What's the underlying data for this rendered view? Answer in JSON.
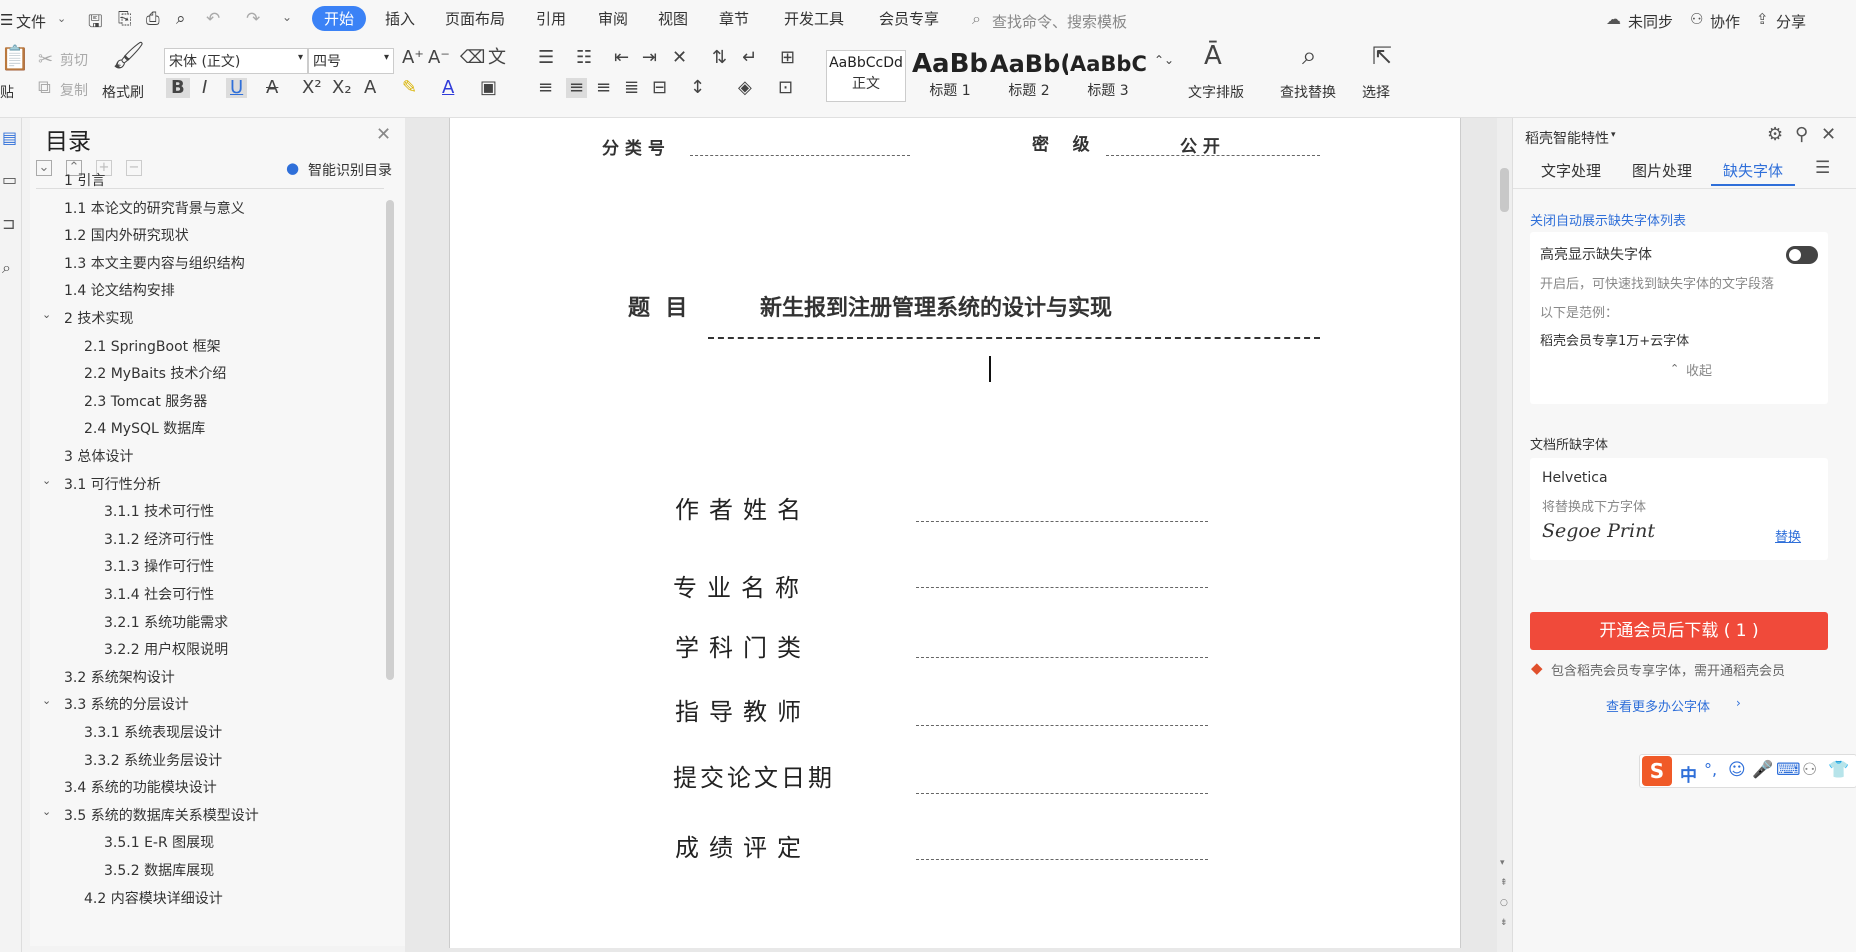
{
  "menu": {
    "file": "文件"
  },
  "tabs": [
    "开始",
    "插入",
    "页面布局",
    "引用",
    "审阅",
    "视图",
    "章节",
    "开发工具",
    "会员专享"
  ],
  "search": {
    "placeholder": "查找命令、搜索模板"
  },
  "top_right": {
    "sync": "未同步",
    "collab": "协作",
    "share": "分享"
  },
  "ribbon": {
    "paste": "贴",
    "cut": "剪切",
    "copy": "复制",
    "format_painter": "格式刷",
    "font_name": "宋体 (正文)",
    "font_size": "四号",
    "styles": [
      {
        "sample": "AaBbCcDd",
        "label": "正文"
      },
      {
        "sample": "AaBb",
        "label": "标题 1"
      },
      {
        "sample": "AaBb(",
        "label": "标题 2"
      },
      {
        "sample": "AaBbC(",
        "label": "标题 3"
      }
    ],
    "text_layout": "文字排版",
    "find_replace": "查找替换",
    "select": "选择"
  },
  "toc": {
    "title": "目录",
    "smart": "智能识别目录",
    "items": [
      {
        "text": "1 引言",
        "indent": 0,
        "caret": false
      },
      {
        "text": "1.1 本论文的研究背景与意义",
        "indent": 0,
        "caret": false
      },
      {
        "text": "1.2 国内外研究现状",
        "indent": 0,
        "caret": false
      },
      {
        "text": "1.3 本文主要内容与组织结构",
        "indent": 0,
        "caret": false
      },
      {
        "text": "1.4  论文结构安排",
        "indent": 0,
        "caret": false
      },
      {
        "text": "2  技术实现",
        "indent": 0,
        "caret": true
      },
      {
        "text": "2.1 SpringBoot 框架",
        "indent": 1,
        "caret": false
      },
      {
        "text": "2.2 MyBaits 技术介绍",
        "indent": 1,
        "caret": false
      },
      {
        "text": "2.3 Tomcat 服务器",
        "indent": 1,
        "caret": false
      },
      {
        "text": "2.4 MySQL 数据库",
        "indent": 1,
        "caret": false
      },
      {
        "text": "3 总体设计",
        "indent": 0,
        "caret": false
      },
      {
        "text": "3.1  可行性分析",
        "indent": 0,
        "caret": true
      },
      {
        "text": "3.1.1  技术可行性",
        "indent": 2,
        "caret": false
      },
      {
        "text": "3.1.2  经济可行性",
        "indent": 2,
        "caret": false
      },
      {
        "text": "3.1.3  操作可行性",
        "indent": 2,
        "caret": false
      },
      {
        "text": "3.1.4  社会可行性",
        "indent": 2,
        "caret": false
      },
      {
        "text": "3.2.1  系统功能需求",
        "indent": 2,
        "caret": false
      },
      {
        "text": "3.2.2  用户权限说明",
        "indent": 2,
        "caret": false
      },
      {
        "text": "3.2 系统架构设计",
        "indent": 0,
        "caret": false
      },
      {
        "text": "3.3 系统的分层设计",
        "indent": 0,
        "caret": true
      },
      {
        "text": "3.3.1  系统表现层设计",
        "indent": 1,
        "caret": false
      },
      {
        "text": "3.3.2  系统业务层设计",
        "indent": 1,
        "caret": false
      },
      {
        "text": "3.4 系统的功能模块设计",
        "indent": 0,
        "caret": false
      },
      {
        "text": "3.5 系统的数据库关系模型设计",
        "indent": 0,
        "caret": true
      },
      {
        "text": "3.5.1 E-R 图展现",
        "indent": 2,
        "caret": false
      },
      {
        "text": "3.5.2 数据库展现",
        "indent": 2,
        "caret": false
      },
      {
        "text": "4.2  内容模块详细设计",
        "indent": 1,
        "caret": false
      }
    ]
  },
  "doc": {
    "class_no": "分 类 号",
    "secret_level": "密    级",
    "secret_value": "公 开",
    "title_label": "题  目",
    "title_value": "新生报到注册管理系统的设计与实现",
    "fields": [
      "作者姓名",
      "专业名称",
      "学科门类",
      "指导教师",
      "提交论文日期",
      "成绩评定"
    ]
  },
  "panel": {
    "header": "稻壳智能特性",
    "tabs": [
      "文字处理",
      "图片处理",
      "缺失字体"
    ],
    "close_auto": "关闭自动展示缺失字体列表",
    "highlight": "高亮显示缺失字体",
    "desc1": "开启后，可快速找到缺失字体的文字段落",
    "desc2": "以下是范例：",
    "example": "稻壳会员专享1万+云字体",
    "collapse": "收起",
    "missing_title": "文档所缺字体",
    "missing_font": "Helvetica",
    "replace_hint": "将替换成下方字体",
    "replace_font": "Segoe Print",
    "replace_btn": "替换",
    "download_btn": "开通会员后下载 ( 1 )",
    "note": "包含稻壳会员专享字体，需开通稻壳会员",
    "more": "查看更多办公字体"
  },
  "ime": {
    "label": "中"
  },
  "colors": {
    "accent": "#3b82f6",
    "download": "#f04a3a",
    "link": "#2f6fd9"
  }
}
